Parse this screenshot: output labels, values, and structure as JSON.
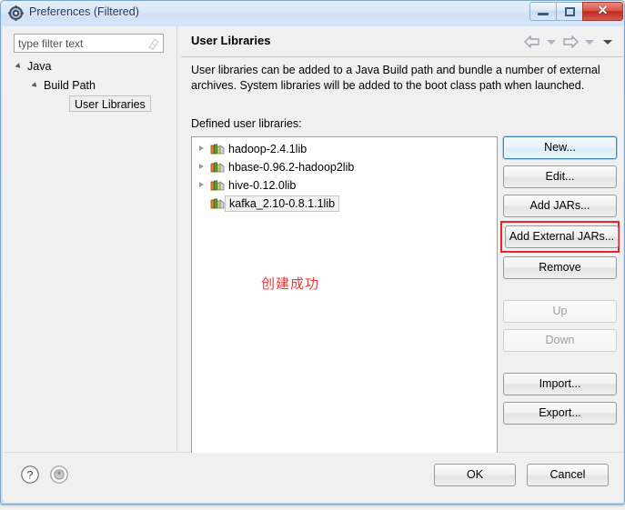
{
  "window": {
    "title": "Preferences (Filtered)",
    "icon": "preferences-gear-icon",
    "controls": {
      "minimize": "Minimize",
      "maximize": "Maximize",
      "close": "Close",
      "close_glyph": "✕"
    }
  },
  "sidebar": {
    "filter": {
      "placeholder": "type filter text",
      "value": "type filter text",
      "clear_icon": "clear-filter-icon"
    },
    "tree": [
      {
        "label": "Java",
        "level": 1,
        "expanded": true,
        "selected": false
      },
      {
        "label": "Build Path",
        "level": 2,
        "expanded": true,
        "selected": false
      },
      {
        "label": "User Libraries",
        "level": 3,
        "expanded": false,
        "selected": true
      }
    ]
  },
  "page": {
    "title": "User Libraries",
    "description": "User libraries can be added to a Java Build path and bundle a number of external archives. System libraries will be added to the boot class path when launched.",
    "list_label": "Defined user libraries:",
    "nav": {
      "back_icon": "back-arrow-icon",
      "back_menu_icon": "chevron-down-icon",
      "forward_icon": "forward-arrow-icon",
      "forward_menu_icon": "chevron-down-icon",
      "menu_icon": "chevron-down-icon"
    }
  },
  "libraries": [
    {
      "name": "hadoop-2.4.1lib",
      "expandable": true,
      "selected": false
    },
    {
      "name": "hbase-0.96.2-hadoop2lib",
      "expandable": true,
      "selected": false
    },
    {
      "name": "hive-0.12.0lib",
      "expandable": true,
      "selected": false
    },
    {
      "name": "kafka_2.10-0.8.1.1lib",
      "expandable": false,
      "selected": true
    }
  ],
  "annotation": {
    "text": "创建成功",
    "color": "#ef3b3b",
    "highlight_color": "#e8252a",
    "highlight_target": "Add External JARs..."
  },
  "side_buttons": [
    {
      "label": "New...",
      "state": "focused"
    },
    {
      "label": "Edit...",
      "state": "enabled"
    },
    {
      "label": "Add JARs...",
      "state": "enabled"
    },
    {
      "label": "Add External JARs...",
      "state": "highlighted"
    },
    {
      "label": "Remove",
      "state": "enabled"
    },
    {
      "label": "Up",
      "state": "disabled"
    },
    {
      "label": "Down",
      "state": "disabled"
    },
    {
      "label": "Import...",
      "state": "enabled"
    },
    {
      "label": "Export...",
      "state": "enabled"
    }
  ],
  "footer": {
    "help_icon": "help-question-icon",
    "info_icon": "info-circle-icon",
    "ok_label": "OK",
    "cancel_label": "Cancel"
  }
}
